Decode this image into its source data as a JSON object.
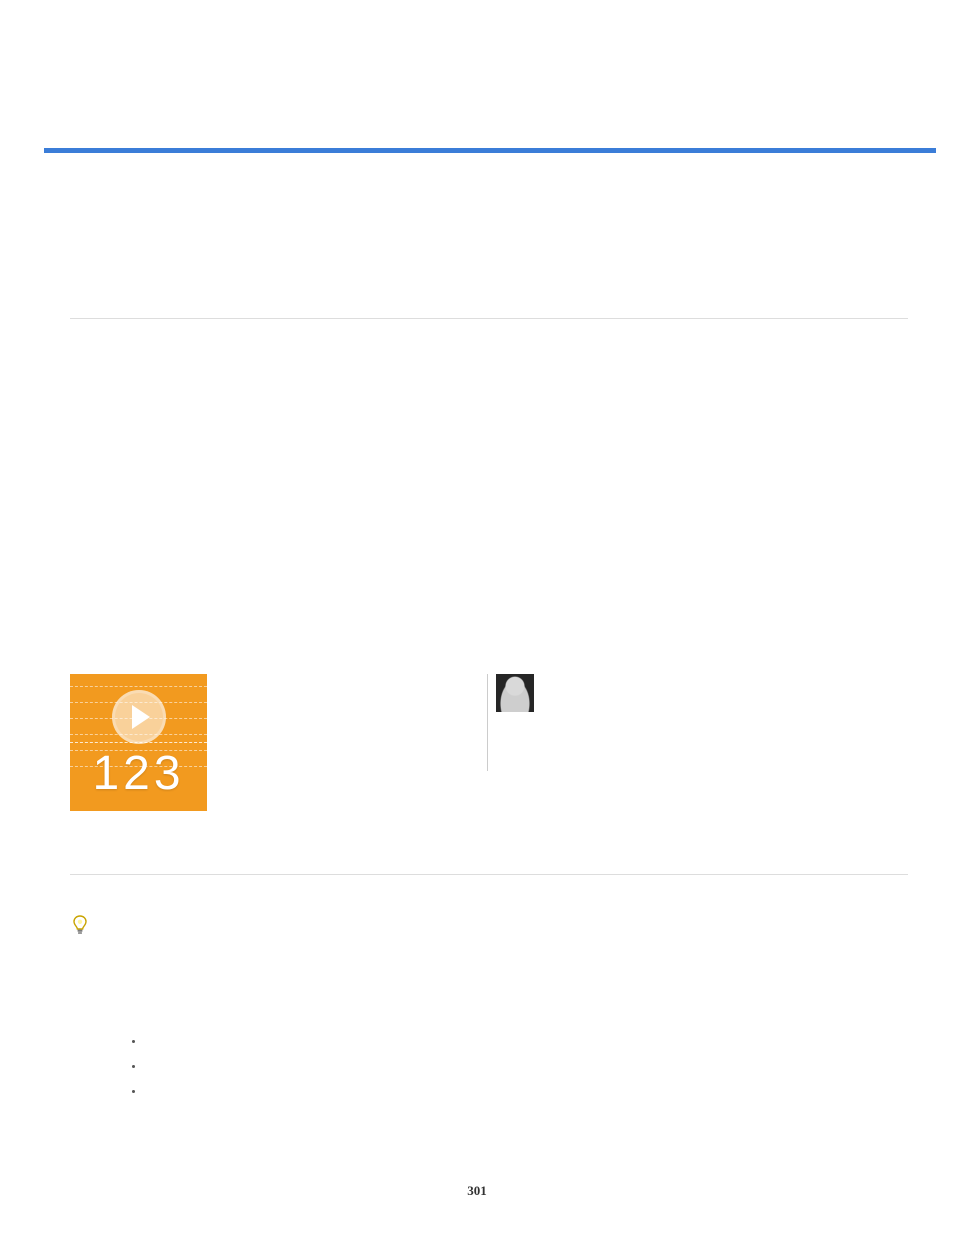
{
  "page_number": "301",
  "video_thumb": {
    "label": "123"
  },
  "bullets": [
    "",
    "",
    ""
  ]
}
